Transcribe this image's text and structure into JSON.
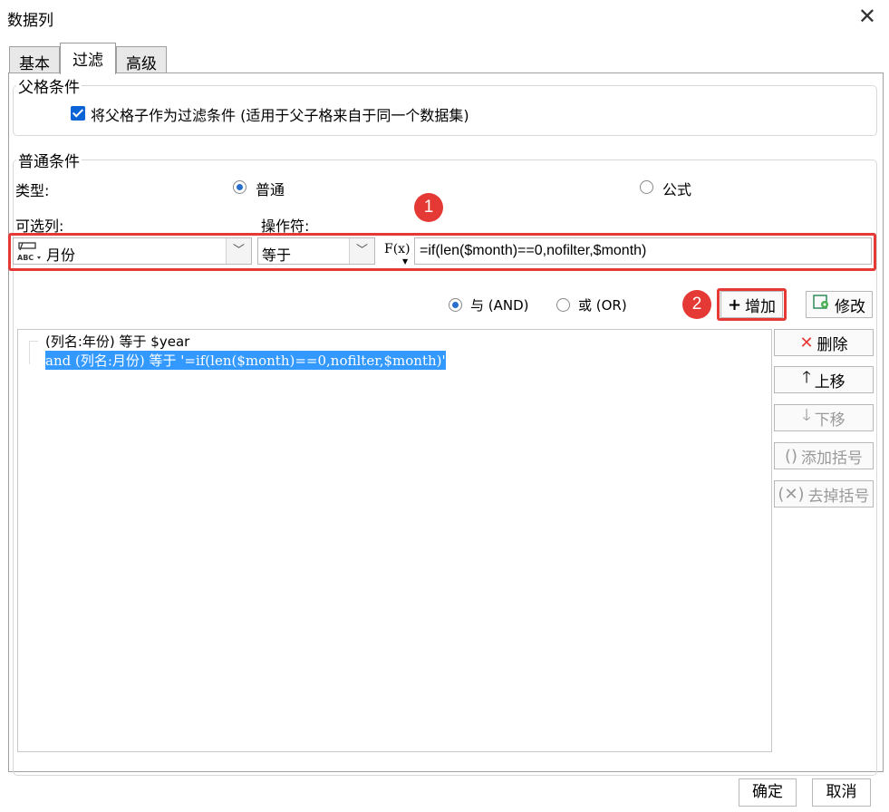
{
  "window": {
    "title": "数据列",
    "close_icon": "close-icon"
  },
  "tabs": [
    {
      "label": "基本"
    },
    {
      "label": "过滤"
    },
    {
      "label": "高级"
    }
  ],
  "parent_condition": {
    "group_title": "父格条件",
    "checkbox_label": "将父格子作为过滤条件 (适用于父子格来自于同一个数据集)",
    "checked": true
  },
  "normal_condition": {
    "group_title": "普通条件",
    "type_label": "类型:",
    "type_options": [
      {
        "label": "普通",
        "checked": true
      },
      {
        "label": "公式",
        "checked": false
      }
    ],
    "column_label": "可选列:",
    "operator_label": "操作符:",
    "column_value": "月份",
    "operator_value": "等于",
    "formula_icon_text": "F(x)",
    "formula_value": "=if(len($month)==0,nofilter,$month)",
    "logic_options": [
      {
        "label": "与 (AND)",
        "checked": true
      },
      {
        "label": "或 (OR)",
        "checked": false
      }
    ]
  },
  "annotations": {
    "badge1": "1",
    "badge2": "2",
    "color": "#e53935"
  },
  "buttons": {
    "add": "增加",
    "modify": "修改",
    "delete": "删除",
    "move_up": "上移",
    "move_down": "下移",
    "add_bracket": "添加括号",
    "remove_bracket": "去掉括号"
  },
  "conditions_list": [
    {
      "text": "(列名:年份) 等于 $year",
      "selected": false
    },
    {
      "text": "and (列名:月份) 等于 '=if(len($month)==0,nofilter,$month)'",
      "selected": true
    }
  ],
  "footer": {
    "ok": "确定",
    "cancel": "取消"
  }
}
